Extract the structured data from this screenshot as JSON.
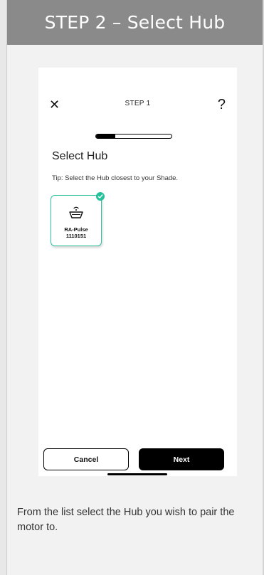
{
  "header": {
    "title": "STEP 2 – Select Hub"
  },
  "phone": {
    "top_bar": {
      "close_symbol": "✕",
      "step_label": "STEP 1",
      "help_symbol": "?"
    },
    "progress": {
      "value_fraction": 0.25
    },
    "title": "Select Hub",
    "tip": "Tip: Select the Hub closest to your Shade.",
    "hub_card": {
      "name": "RA-Pulse",
      "serial": "1110151",
      "selected": true,
      "icon": "hub-router-icon",
      "check_icon": "check-icon",
      "accent_color": "#22c29b"
    },
    "buttons": {
      "cancel_label": "Cancel",
      "next_label": "Next"
    }
  },
  "instruction": "From the list select the Hub you wish to pair the motor to.",
  "colors": {
    "header_bg": "#8a8a8a",
    "page_bg": "#f2f2f2",
    "accent": "#22c29b"
  }
}
